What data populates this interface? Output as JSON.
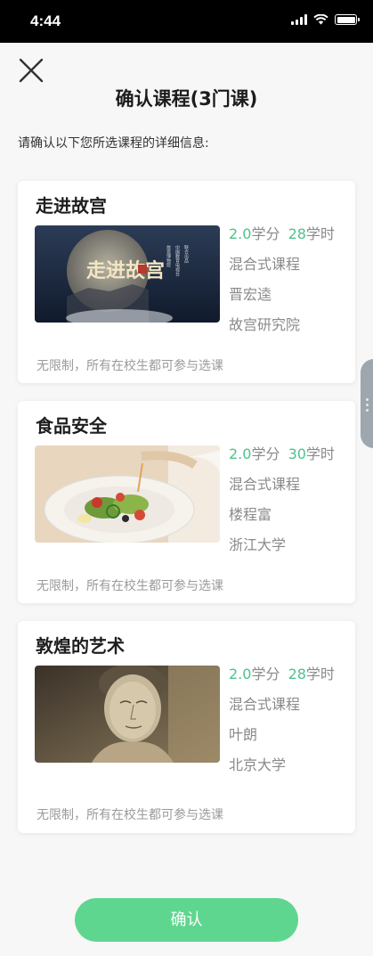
{
  "status_bar": {
    "time": "4:44"
  },
  "header": {
    "title": "确认课程(3门课)",
    "subtitle": "请确认以下您所选课程的详细信息:"
  },
  "courses": [
    {
      "name": "走进故宫",
      "credits": "2.0",
      "credit_unit": "学分",
      "hours": "28",
      "hour_unit": "学时",
      "type": "混合式课程",
      "teacher": "晋宏逵",
      "institution": "故宫研究院",
      "restriction": "无限制，所有在校生都可参与选课",
      "thumbnail_text": "走进故宫"
    },
    {
      "name": "食品安全",
      "credits": "2.0",
      "credit_unit": "学分",
      "hours": "30",
      "hour_unit": "学时",
      "type": "混合式课程",
      "teacher": "楼程富",
      "institution": "浙江大学",
      "restriction": "无限制，所有在校生都可参与选课"
    },
    {
      "name": "敦煌的艺术",
      "credits": "2.0",
      "credit_unit": "学分",
      "hours": "28",
      "hour_unit": "学时",
      "type": "混合式课程",
      "teacher": "叶朗",
      "institution": "北京大学",
      "restriction": "无限制，所有在校生都可参与选课"
    }
  ],
  "footer": {
    "confirm_label": "确认"
  },
  "colors": {
    "accent_green": "#4cc38a",
    "button_green": "#5fd68f"
  }
}
